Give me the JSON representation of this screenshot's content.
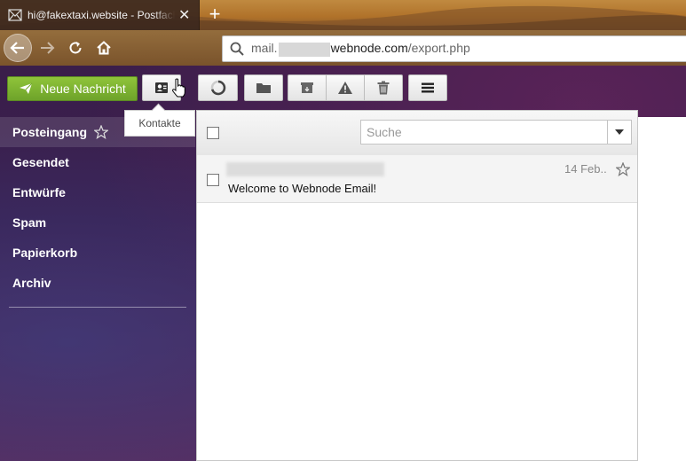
{
  "browser": {
    "tab_title": "hi@fakextaxi.website - Postfach",
    "url_prefix": "mail.",
    "url_domain": "webnode.com",
    "url_path": "/export.php"
  },
  "toolbar": {
    "compose_label": "Neue Nachricht",
    "tooltip": "Kontakte"
  },
  "sidebar": {
    "folders": [
      {
        "label": "Posteingang"
      },
      {
        "label": "Gesendet"
      },
      {
        "label": "Entwürfe"
      },
      {
        "label": "Spam"
      },
      {
        "label": "Papierkorb"
      },
      {
        "label": "Archiv"
      }
    ]
  },
  "list": {
    "search_placeholder": "Suche",
    "messages": [
      {
        "subject": "Welcome to Webnode Email!",
        "date": "14 Feb.."
      }
    ]
  },
  "colors": {
    "accent_green": "#7ab332",
    "sidebar_bg": "#3a1e4a"
  }
}
